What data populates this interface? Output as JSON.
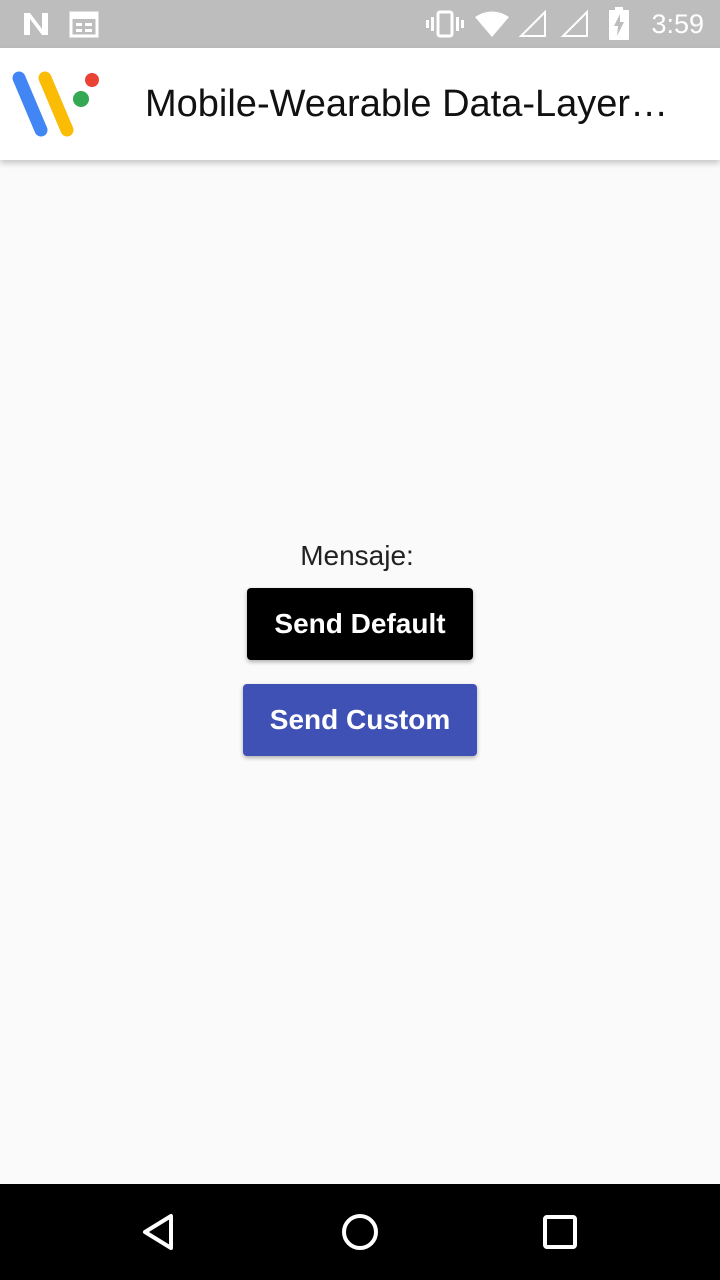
{
  "status_bar": {
    "time": "3:59",
    "icons": [
      "notification-n-icon",
      "calendar-icon",
      "vibrate-icon",
      "wifi-icon",
      "signal-icon",
      "signal-icon",
      "battery-charging-icon"
    ]
  },
  "app_bar": {
    "title": "Mobile-Wearable Data-Layer…",
    "logo_colors": [
      "#4285f4",
      "#fbbc05",
      "#34a853",
      "#ea4335"
    ]
  },
  "main": {
    "message_label": "Mensaje:",
    "send_default_label": "Send Default",
    "send_custom_label": "Send Custom",
    "send_default_color": "#000000",
    "send_custom_color": "#3f51b5"
  },
  "nav_bar": {
    "buttons": [
      "back-icon",
      "home-icon",
      "recents-icon"
    ]
  }
}
